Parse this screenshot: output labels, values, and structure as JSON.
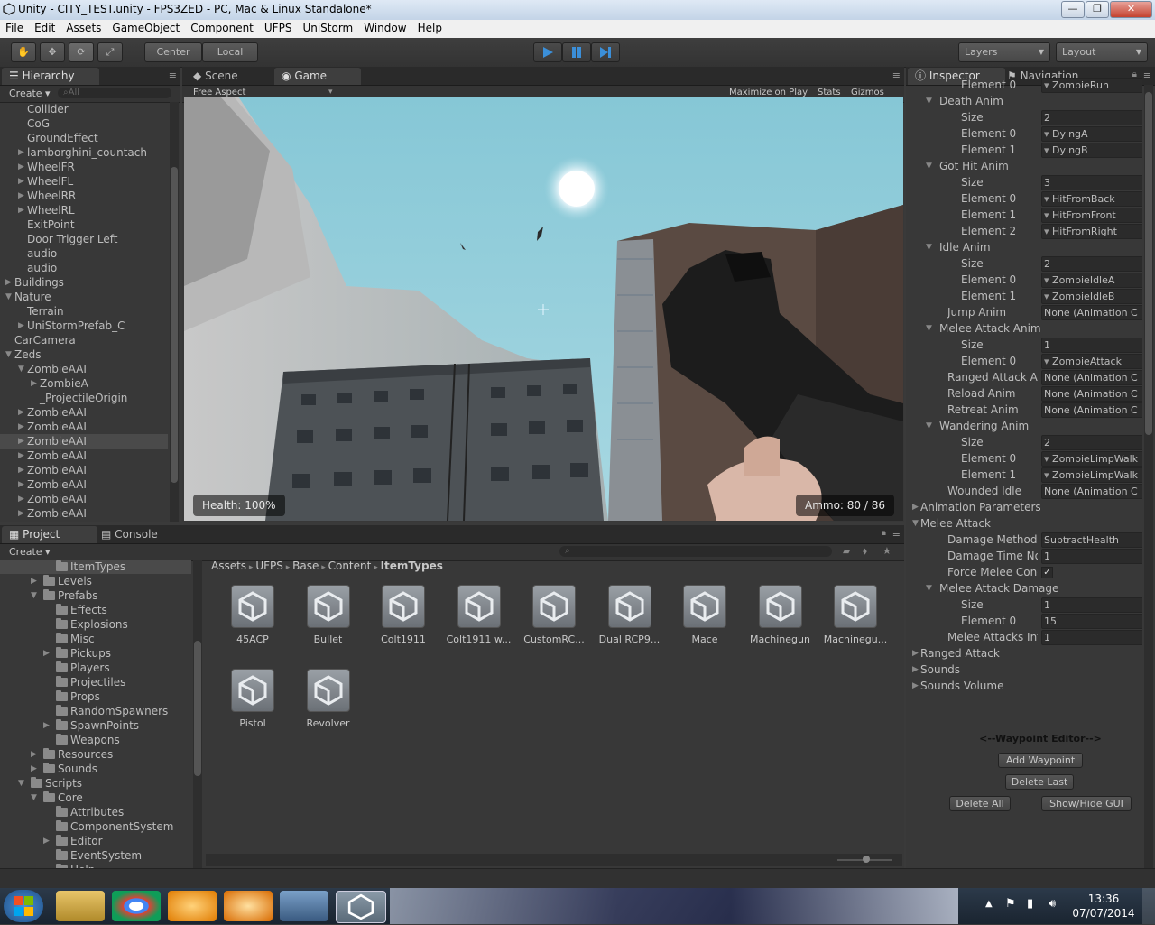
{
  "window": {
    "title": "Unity - CITY_TEST.unity - FPS3ZED - PC, Mac & Linux Standalone*",
    "minimize": "—",
    "maximize": "❐",
    "close": "✕"
  },
  "menu": [
    "File",
    "Edit",
    "Assets",
    "GameObject",
    "Component",
    "UFPS",
    "UniStorm",
    "Window",
    "Help"
  ],
  "toolbar": {
    "center": "Center",
    "local": "Local",
    "layers": "Layers",
    "layout": "Layout"
  },
  "hierarchy": {
    "tab": "Hierarchy",
    "create": "Create",
    "search_placeholder": "All",
    "items": [
      {
        "label": "Collider",
        "indent": 2,
        "arrow": false
      },
      {
        "label": "CoG",
        "indent": 2,
        "arrow": false
      },
      {
        "label": "GroundEffect",
        "indent": 2,
        "arrow": false
      },
      {
        "label": "lamborghini_countach",
        "indent": 2,
        "arrow": true
      },
      {
        "label": "WheelFR",
        "indent": 2,
        "arrow": true
      },
      {
        "label": "WheelFL",
        "indent": 2,
        "arrow": true
      },
      {
        "label": "WheelRR",
        "indent": 2,
        "arrow": true
      },
      {
        "label": "WheelRL",
        "indent": 2,
        "arrow": true
      },
      {
        "label": "ExitPoint",
        "indent": 2,
        "arrow": false
      },
      {
        "label": "Door Trigger Left",
        "indent": 2,
        "arrow": false
      },
      {
        "label": "audio",
        "indent": 2,
        "arrow": false
      },
      {
        "label": "audio",
        "indent": 2,
        "arrow": false
      },
      {
        "label": "Buildings",
        "indent": 1,
        "arrow": true
      },
      {
        "label": "Nature",
        "indent": 1,
        "arrow": true,
        "open": true
      },
      {
        "label": "Terrain",
        "indent": 2,
        "arrow": false
      },
      {
        "label": "UniStormPrefab_C",
        "indent": 2,
        "arrow": true
      },
      {
        "label": "CarCamera",
        "indent": 1,
        "arrow": false
      },
      {
        "label": "Zeds",
        "indent": 1,
        "arrow": true,
        "open": true
      },
      {
        "label": "ZombieAAI",
        "indent": 2,
        "arrow": true,
        "open": true
      },
      {
        "label": "ZombieA",
        "indent": 3,
        "arrow": true
      },
      {
        "label": "_ProjectileOrigin",
        "indent": 3,
        "arrow": false
      },
      {
        "label": "ZombieAAI",
        "indent": 2,
        "arrow": true
      },
      {
        "label": "ZombieAAI",
        "indent": 2,
        "arrow": true
      },
      {
        "label": "ZombieAAI",
        "indent": 2,
        "arrow": true,
        "selected": true
      },
      {
        "label": "ZombieAAI",
        "indent": 2,
        "arrow": true
      },
      {
        "label": "ZombieAAI",
        "indent": 2,
        "arrow": true
      },
      {
        "label": "ZombieAAI",
        "indent": 2,
        "arrow": true
      },
      {
        "label": "ZombieAAI",
        "indent": 2,
        "arrow": true
      },
      {
        "label": "ZombieAAI",
        "indent": 2,
        "arrow": true
      }
    ]
  },
  "viewtabs": {
    "scene": "Scene",
    "game": "Game",
    "aspect": "Free Aspect",
    "maximize": "Maximize on Play",
    "stats": "Stats",
    "gizmos": "Gizmos"
  },
  "game": {
    "health": "Health: 100%",
    "ammo": "Ammo: 80 / 86"
  },
  "project": {
    "tab": "Project",
    "console_tab": "Console",
    "create": "Create",
    "breadcrumb": [
      "Assets",
      "UFPS",
      "Base",
      "Content",
      "ItemTypes"
    ],
    "tree": [
      {
        "label": "ItemTypes",
        "indent": 4,
        "arrow": false,
        "selected": true
      },
      {
        "label": "Levels",
        "indent": 3,
        "arrow": true
      },
      {
        "label": "Prefabs",
        "indent": 3,
        "arrow": true,
        "open": true
      },
      {
        "label": "Effects",
        "indent": 4,
        "arrow": false
      },
      {
        "label": "Explosions",
        "indent": 4,
        "arrow": false
      },
      {
        "label": "Misc",
        "indent": 4,
        "arrow": false
      },
      {
        "label": "Pickups",
        "indent": 4,
        "arrow": true
      },
      {
        "label": "Players",
        "indent": 4,
        "arrow": false
      },
      {
        "label": "Projectiles",
        "indent": 4,
        "arrow": false
      },
      {
        "label": "Props",
        "indent": 4,
        "arrow": false
      },
      {
        "label": "RandomSpawners",
        "indent": 4,
        "arrow": false
      },
      {
        "label": "SpawnPoints",
        "indent": 4,
        "arrow": true
      },
      {
        "label": "Weapons",
        "indent": 4,
        "arrow": false
      },
      {
        "label": "Resources",
        "indent": 3,
        "arrow": true
      },
      {
        "label": "Sounds",
        "indent": 3,
        "arrow": true
      },
      {
        "label": "Scripts",
        "indent": 2,
        "arrow": true,
        "open": true
      },
      {
        "label": "Core",
        "indent": 3,
        "arrow": true,
        "open": true
      },
      {
        "label": "Attributes",
        "indent": 4,
        "arrow": false
      },
      {
        "label": "ComponentSystem",
        "indent": 4,
        "arrow": false
      },
      {
        "label": "Editor",
        "indent": 4,
        "arrow": true
      },
      {
        "label": "EventSystem",
        "indent": 4,
        "arrow": false
      },
      {
        "label": "Help",
        "indent": 4,
        "arrow": false
      }
    ],
    "assets": [
      "45ACP",
      "Bullet",
      "Colt1911",
      "Colt1911 w...",
      "CustomRC...",
      "Dual RCP9...",
      "Mace",
      "Machinegun",
      "Machinegu...",
      "Pistol",
      "Revolver"
    ]
  },
  "inspector": {
    "tab": "Inspector",
    "nav_tab": "Navigation",
    "rows": [
      {
        "label": "Element 0",
        "indent": 3,
        "value": "ZombieRun",
        "obj": true
      },
      {
        "label": "Death Anim",
        "indent": 2,
        "fold": true
      },
      {
        "label": "Size",
        "indent": 3,
        "value": "2"
      },
      {
        "label": "Element 0",
        "indent": 3,
        "value": "DyingA",
        "obj": true
      },
      {
        "label": "Element 1",
        "indent": 3,
        "value": "DyingB",
        "obj": true
      },
      {
        "label": "Got Hit Anim",
        "indent": 2,
        "fold": true
      },
      {
        "label": "Size",
        "indent": 3,
        "value": "3"
      },
      {
        "label": "Element 0",
        "indent": 3,
        "value": "HitFromBack",
        "obj": true
      },
      {
        "label": "Element 1",
        "indent": 3,
        "value": "HitFromFront",
        "obj": true
      },
      {
        "label": "Element 2",
        "indent": 3,
        "value": "HitFromRight",
        "obj": true
      },
      {
        "label": "Idle Anim",
        "indent": 2,
        "fold": true
      },
      {
        "label": "Size",
        "indent": 3,
        "value": "2"
      },
      {
        "label": "Element 0",
        "indent": 3,
        "value": "ZombieIdleA",
        "obj": true
      },
      {
        "label": "Element 1",
        "indent": 3,
        "value": "ZombieIdleB",
        "obj": true
      },
      {
        "label": "Jump Anim",
        "indent": 2,
        "value": "None (Animation C"
      },
      {
        "label": "Melee Attack Anim",
        "indent": 2,
        "fold": true
      },
      {
        "label": "Size",
        "indent": 3,
        "value": "1"
      },
      {
        "label": "Element 0",
        "indent": 3,
        "value": "ZombieAttack",
        "obj": true
      },
      {
        "label": "Ranged Attack Anim",
        "indent": 2,
        "value": "None (Animation C"
      },
      {
        "label": "Reload Anim",
        "indent": 2,
        "value": "None (Animation C"
      },
      {
        "label": "Retreat Anim",
        "indent": 2,
        "value": "None (Animation C"
      },
      {
        "label": "Wandering Anim",
        "indent": 2,
        "fold": true
      },
      {
        "label": "Size",
        "indent": 3,
        "value": "2"
      },
      {
        "label": "Element 0",
        "indent": 3,
        "value": "ZombieLimpWalk",
        "obj": true
      },
      {
        "label": "Element 1",
        "indent": 3,
        "value": "ZombieLimpWalk",
        "obj": true
      },
      {
        "label": "Wounded Idle",
        "indent": 2,
        "value": "None (Animation C"
      },
      {
        "label": "Animation Parameters",
        "indent": 1,
        "foldc": true
      },
      {
        "label": "Melee Attack",
        "indent": 1,
        "fold": true
      },
      {
        "label": "Damage Method Nar",
        "indent": 2,
        "value": "SubtractHealth"
      },
      {
        "label": "Damage Time Norm.",
        "indent": 2,
        "value": "1"
      },
      {
        "label": "Force Melee Conclud",
        "indent": 2,
        "check": true
      },
      {
        "label": "Melee Attack Damage",
        "indent": 2,
        "fold": true
      },
      {
        "label": "Size",
        "indent": 3,
        "value": "1"
      },
      {
        "label": "Element 0",
        "indent": 3,
        "value": "15"
      },
      {
        "label": "Melee Attacks Interv",
        "indent": 2,
        "value": "1"
      },
      {
        "label": "Ranged Attack",
        "indent": 1,
        "foldc": true
      },
      {
        "label": "Sounds",
        "indent": 1,
        "foldc": true
      },
      {
        "label": "Sounds Volume",
        "indent": 1,
        "foldc": true
      }
    ],
    "waypoint_title": "<--Waypoint Editor-->",
    "add_waypoint": "Add Waypoint",
    "delete_last": "Delete Last",
    "delete_all": "Delete All",
    "show_hide": "Show/Hide GUI"
  },
  "taskbar": {
    "time": "13:36",
    "date": "07/07/2014"
  }
}
